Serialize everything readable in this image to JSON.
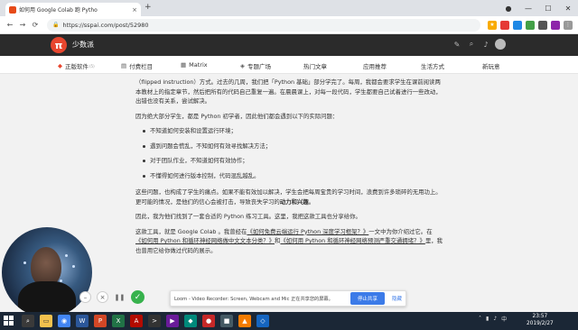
{
  "browser": {
    "tab_title": "如何用 Google Colab 跑 Pytho",
    "url": "https://sspai.com/post/52980",
    "back_icon": "arrow-left-icon",
    "forward_icon": "arrow-right-icon",
    "reload_icon": "reload-icon"
  },
  "site": {
    "brand": "少数派",
    "logo_glyph": "π",
    "accent": "#e8462e"
  },
  "categories": [
    {
      "label": "正版软件",
      "icon": "tag-icon"
    },
    {
      "label": "付费栏目",
      "icon": "column-icon"
    },
    {
      "label": "Matrix",
      "icon": "matrix-icon"
    },
    {
      "label": "专题广场",
      "icon": "square-icon"
    },
    {
      "label": "热门文章",
      "icon": ""
    },
    {
      "label": "应用推荐",
      "icon": ""
    },
    {
      "label": "生活方式",
      "icon": ""
    },
    {
      "label": "新玩意",
      "icon": ""
    }
  ],
  "article": {
    "p1": "（flipped instruction）方式。过去的几周，我们把「Python 基础」部分学完了。每周，我都会要求学生在课前阅读两本教材上的指定章节，然后把所有的代码自己重复一遍。在晨晨课上，对每一段代码，学生都要自己试着进行一些改动，出错也没有关系，尝试解决。",
    "p2": "因为绝大部分学生，都是 Python 初学者，因此他们都会遇到以下的实际问题：",
    "bullets": [
      "不知道如何安装和设置运行环境；",
      "遇到问题会慌乱，不知如何有效寻找解决方法；",
      "对于团队作业，不知道如何有效协作；",
      "不懂得如何进行版本控制，代码混乱越乱。"
    ],
    "p3_a": "这些问题，也构成了学生的痛点。如果不能有效加以解决，学生会把每周宝贵的学习时间，浪费到许多琐碎的无用功上。更可能的情况，是他们的信心会被打击，导致丧失学习的",
    "p3_b": "动力和兴趣",
    "p3_c": "。",
    "p4": "因此，我为他们找到了一套合适的 Python 练习工具。这里，我把这款工具也分享给你。",
    "p5_a": "这款工具，就是 Google Colab 。我曾经在",
    "p5_link1": "《如何免费云端运行 Python 深度学习框架？》",
    "p5_b": "一文中为你介绍过它。在",
    "p5_link2": "《如何用 Python 和循环神经网络做中文文本分类？》",
    "p5_c": "和",
    "p5_link3": "《如何用 Python 和循环神经网络预测严重交通拥堵？》",
    "p5_d": "里，我也曾用它给你做过代码的展示。"
  },
  "loom": {
    "share_message": "Loom - Video Recorder: Screen, Webcam and Mic 正在共享您的屏幕。",
    "stop_label": "停止共享",
    "hide_label": "隐藏"
  },
  "taskbar": {
    "apps": [
      "folder-icon",
      "chrome-icon",
      "word-icon",
      "powerpoint-icon",
      "excel-icon",
      "acrobat-icon",
      "terminal-icon",
      "video-icon",
      "app-icon",
      "app-icon",
      "app-icon",
      "app-icon",
      "app-icon"
    ],
    "time": "23:57",
    "date": "2019/2/27"
  }
}
